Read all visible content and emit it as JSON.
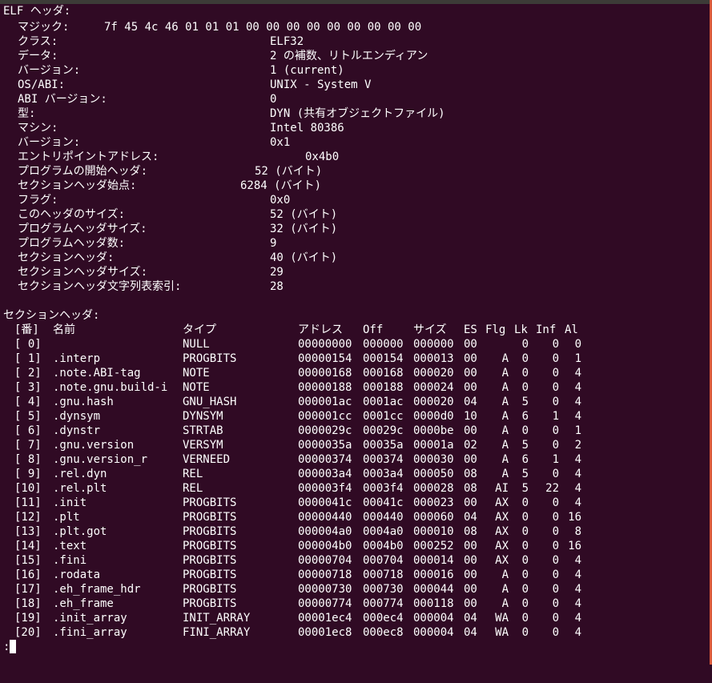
{
  "elf_header": {
    "title": "ELF ヘッダ:",
    "magic": {
      "label": "マジック:",
      "value": "7f 45 4c 46 01 01 01 00 00 00 00 00 00 00 00 00"
    },
    "class": {
      "label": "クラス:",
      "value": "ELF32"
    },
    "data": {
      "label": "データ:",
      "value": "2 の補数、リトルエンディアン"
    },
    "version": {
      "label": "バージョン:",
      "value": "1 (current)"
    },
    "os_abi": {
      "label": "OS/ABI:",
      "value": "UNIX - System V"
    },
    "abi_version": {
      "label": "ABI バージョン:",
      "value": "0"
    },
    "type": {
      "label": "型:",
      "value": "DYN (共有オブジェクトファイル)"
    },
    "machine": {
      "label": "マシン:",
      "value": "Intel 80386"
    },
    "version2": {
      "label": "バージョン:",
      "value": "0x1"
    },
    "entry": {
      "label": "エントリポイントアドレス:",
      "value": "0x4b0"
    },
    "ph_start": {
      "label": "プログラムの開始ヘッダ:",
      "value": "52 (バイト)"
    },
    "sh_start": {
      "label": "セクションヘッダ始点:",
      "value": "6284 (バイト)"
    },
    "flags": {
      "label": "フラグ:",
      "value": "0x0"
    },
    "header_size": {
      "label": "このヘッダのサイズ:",
      "value": "52 (バイト)"
    },
    "ph_size": {
      "label": "プログラムヘッダサイズ:",
      "value": "32 (バイト)"
    },
    "ph_count": {
      "label": "プログラムヘッダ数:",
      "value": "9"
    },
    "sh_size": {
      "label": "セクションヘッダ:",
      "value": "40 (バイト)"
    },
    "sh_count": {
      "label": "セクションヘッダサイズ:",
      "value": "29"
    },
    "sh_strndx": {
      "label": "セクションヘッダ文字列表索引:",
      "value": "28"
    }
  },
  "section_headers": {
    "title": "セクションヘッダ:",
    "columns": {
      "nr": "[番]",
      "name": "名前",
      "type": "タイプ",
      "addr": "アドレス",
      "off": "Off",
      "size": "サイズ",
      "es": "ES",
      "flg": "Flg",
      "lk": "Lk",
      "inf": "Inf",
      "al": "Al"
    },
    "rows": [
      {
        "nr": "[ 0]",
        "name": "",
        "type": "NULL",
        "addr": "00000000",
        "off": "000000",
        "size": "000000",
        "es": "00",
        "flg": "",
        "lk": "0",
        "inf": "0",
        "al": "0"
      },
      {
        "nr": "[ 1]",
        "name": ".interp",
        "type": "PROGBITS",
        "addr": "00000154",
        "off": "000154",
        "size": "000013",
        "es": "00",
        "flg": "A",
        "lk": "0",
        "inf": "0",
        "al": "1"
      },
      {
        "nr": "[ 2]",
        "name": ".note.ABI-tag",
        "type": "NOTE",
        "addr": "00000168",
        "off": "000168",
        "size": "000020",
        "es": "00",
        "flg": "A",
        "lk": "0",
        "inf": "0",
        "al": "4"
      },
      {
        "nr": "[ 3]",
        "name": ".note.gnu.build-i",
        "type": "NOTE",
        "addr": "00000188",
        "off": "000188",
        "size": "000024",
        "es": "00",
        "flg": "A",
        "lk": "0",
        "inf": "0",
        "al": "4"
      },
      {
        "nr": "[ 4]",
        "name": ".gnu.hash",
        "type": "GNU_HASH",
        "addr": "000001ac",
        "off": "0001ac",
        "size": "000020",
        "es": "04",
        "flg": "A",
        "lk": "5",
        "inf": "0",
        "al": "4"
      },
      {
        "nr": "[ 5]",
        "name": ".dynsym",
        "type": "DYNSYM",
        "addr": "000001cc",
        "off": "0001cc",
        "size": "0000d0",
        "es": "10",
        "flg": "A",
        "lk": "6",
        "inf": "1",
        "al": "4"
      },
      {
        "nr": "[ 6]",
        "name": ".dynstr",
        "type": "STRTAB",
        "addr": "0000029c",
        "off": "00029c",
        "size": "0000be",
        "es": "00",
        "flg": "A",
        "lk": "0",
        "inf": "0",
        "al": "1"
      },
      {
        "nr": "[ 7]",
        "name": ".gnu.version",
        "type": "VERSYM",
        "addr": "0000035a",
        "off": "00035a",
        "size": "00001a",
        "es": "02",
        "flg": "A",
        "lk": "5",
        "inf": "0",
        "al": "2"
      },
      {
        "nr": "[ 8]",
        "name": ".gnu.version_r",
        "type": "VERNEED",
        "addr": "00000374",
        "off": "000374",
        "size": "000030",
        "es": "00",
        "flg": "A",
        "lk": "6",
        "inf": "1",
        "al": "4"
      },
      {
        "nr": "[ 9]",
        "name": ".rel.dyn",
        "type": "REL",
        "addr": "000003a4",
        "off": "0003a4",
        "size": "000050",
        "es": "08",
        "flg": "A",
        "lk": "5",
        "inf": "0",
        "al": "4"
      },
      {
        "nr": "[10]",
        "name": ".rel.plt",
        "type": "REL",
        "addr": "000003f4",
        "off": "0003f4",
        "size": "000028",
        "es": "08",
        "flg": "AI",
        "lk": "5",
        "inf": "22",
        "al": "4"
      },
      {
        "nr": "[11]",
        "name": ".init",
        "type": "PROGBITS",
        "addr": "0000041c",
        "off": "00041c",
        "size": "000023",
        "es": "00",
        "flg": "AX",
        "lk": "0",
        "inf": "0",
        "al": "4"
      },
      {
        "nr": "[12]",
        "name": ".plt",
        "type": "PROGBITS",
        "addr": "00000440",
        "off": "000440",
        "size": "000060",
        "es": "04",
        "flg": "AX",
        "lk": "0",
        "inf": "0",
        "al": "16"
      },
      {
        "nr": "[13]",
        "name": ".plt.got",
        "type": "PROGBITS",
        "addr": "000004a0",
        "off": "0004a0",
        "size": "000010",
        "es": "08",
        "flg": "AX",
        "lk": "0",
        "inf": "0",
        "al": "8"
      },
      {
        "nr": "[14]",
        "name": ".text",
        "type": "PROGBITS",
        "addr": "000004b0",
        "off": "0004b0",
        "size": "000252",
        "es": "00",
        "flg": "AX",
        "lk": "0",
        "inf": "0",
        "al": "16"
      },
      {
        "nr": "[15]",
        "name": ".fini",
        "type": "PROGBITS",
        "addr": "00000704",
        "off": "000704",
        "size": "000014",
        "es": "00",
        "flg": "AX",
        "lk": "0",
        "inf": "0",
        "al": "4"
      },
      {
        "nr": "[16]",
        "name": ".rodata",
        "type": "PROGBITS",
        "addr": "00000718",
        "off": "000718",
        "size": "000016",
        "es": "00",
        "flg": "A",
        "lk": "0",
        "inf": "0",
        "al": "4"
      },
      {
        "nr": "[17]",
        "name": ".eh_frame_hdr",
        "type": "PROGBITS",
        "addr": "00000730",
        "off": "000730",
        "size": "000044",
        "es": "00",
        "flg": "A",
        "lk": "0",
        "inf": "0",
        "al": "4"
      },
      {
        "nr": "[18]",
        "name": ".eh_frame",
        "type": "PROGBITS",
        "addr": "00000774",
        "off": "000774",
        "size": "000118",
        "es": "00",
        "flg": "A",
        "lk": "0",
        "inf": "0",
        "al": "4"
      },
      {
        "nr": "[19]",
        "name": ".init_array",
        "type": "INIT_ARRAY",
        "addr": "00001ec4",
        "off": "000ec4",
        "size": "000004",
        "es": "04",
        "flg": "WA",
        "lk": "0",
        "inf": "0",
        "al": "4"
      },
      {
        "nr": "[20]",
        "name": ".fini_array",
        "type": "FINI_ARRAY",
        "addr": "00001ec8",
        "off": "000ec8",
        "size": "000004",
        "es": "04",
        "flg": "WA",
        "lk": "0",
        "inf": "0",
        "al": "4"
      }
    ]
  },
  "pager": {
    "prompt": ":"
  }
}
